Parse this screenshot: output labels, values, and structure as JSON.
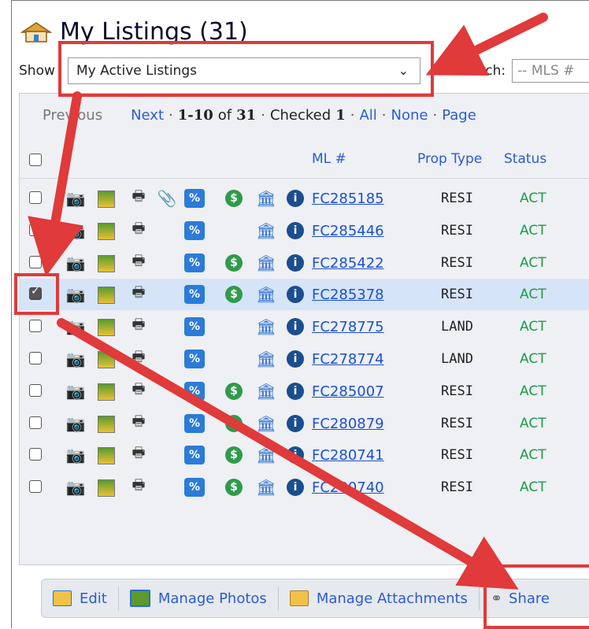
{
  "header": {
    "title": "My Listings (31)"
  },
  "filter": {
    "show_label": "Show",
    "selected": "My Active Listings",
    "search_label": "Search:",
    "search_placeholder": "-- MLS #"
  },
  "pager": {
    "previous": "Previous",
    "next": "Next",
    "range": "1-10",
    "of_word": "of",
    "total": "31",
    "checked_label": "Checked",
    "checked_count": "1",
    "all": "All",
    "none": "None",
    "page": "Page"
  },
  "columns": {
    "ml": "ML #",
    "prop_type": "Prop Type",
    "status": "Status"
  },
  "rows": [
    {
      "ml": "FC285185",
      "type": "RESI",
      "status": "ACT",
      "checked": false,
      "clip": true,
      "money": true
    },
    {
      "ml": "FC285446",
      "type": "RESI",
      "status": "ACT",
      "checked": false,
      "clip": false,
      "money": false
    },
    {
      "ml": "FC285422",
      "type": "RESI",
      "status": "ACT",
      "checked": false,
      "clip": false,
      "money": true
    },
    {
      "ml": "FC285378",
      "type": "RESI",
      "status": "ACT",
      "checked": true,
      "clip": false,
      "money": true
    },
    {
      "ml": "FC278775",
      "type": "LAND",
      "status": "ACT",
      "checked": false,
      "clip": false,
      "money": false
    },
    {
      "ml": "FC278774",
      "type": "LAND",
      "status": "ACT",
      "checked": false,
      "clip": false,
      "money": false
    },
    {
      "ml": "FC285007",
      "type": "RESI",
      "status": "ACT",
      "checked": false,
      "clip": false,
      "money": true
    },
    {
      "ml": "FC280879",
      "type": "RESI",
      "status": "ACT",
      "checked": false,
      "clip": false,
      "money": true
    },
    {
      "ml": "FC280741",
      "type": "RESI",
      "status": "ACT",
      "checked": false,
      "clip": false,
      "money": true
    },
    {
      "ml": "FC280740",
      "type": "RESI",
      "status": "ACT",
      "checked": false,
      "clip": false,
      "money": true
    }
  ],
  "toolbar": {
    "edit": "Edit",
    "manage_photos": "Manage Photos",
    "manage_attachments": "Manage Attachments",
    "share": "Share"
  },
  "colors": {
    "link": "#2a5bd7",
    "status": "#1e9b45",
    "annotation": "#e03a3a",
    "checked_row": "#d6e4f8"
  }
}
